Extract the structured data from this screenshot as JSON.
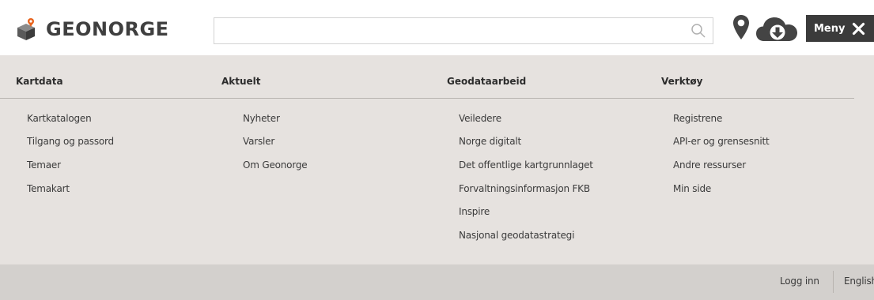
{
  "header": {
    "logo_text": "GEONORGE",
    "search_placeholder": "",
    "search_icon": "search-icon",
    "map_pin_icon": "map-pin-icon",
    "download_icon": "cloud-download-icon",
    "menu_label": "Meny",
    "close_icon": "close-icon",
    "colors": {
      "menu_bg": "#3b3b3b",
      "logo_orange": "#e8631c",
      "logo_gray": "#4a4a4a"
    }
  },
  "menu": {
    "columns": [
      {
        "title": "Kartdata",
        "items": [
          "Kartkatalogen",
          "Tilgang og passord",
          "Temaer",
          "Temakart"
        ]
      },
      {
        "title": "Aktuelt",
        "items": [
          "Nyheter",
          "Varsler",
          "Om Geonorge"
        ]
      },
      {
        "title": "Geodataarbeid",
        "items": [
          "Veiledere",
          "Norge digitalt",
          "Det offentlige kartgrunnlaget",
          "Forvaltningsinformasjon FKB",
          "Inspire",
          "Nasjonal geodatastrategi"
        ]
      },
      {
        "title": "Verktøy",
        "items": [
          "Registrene",
          "API-er og grensesnitt",
          "Andre ressurser",
          "Min side"
        ]
      }
    ],
    "background": "#e6e2df"
  },
  "footer": {
    "login_label": "Logg inn",
    "language_label": "English",
    "background": "#d3d0cd"
  }
}
